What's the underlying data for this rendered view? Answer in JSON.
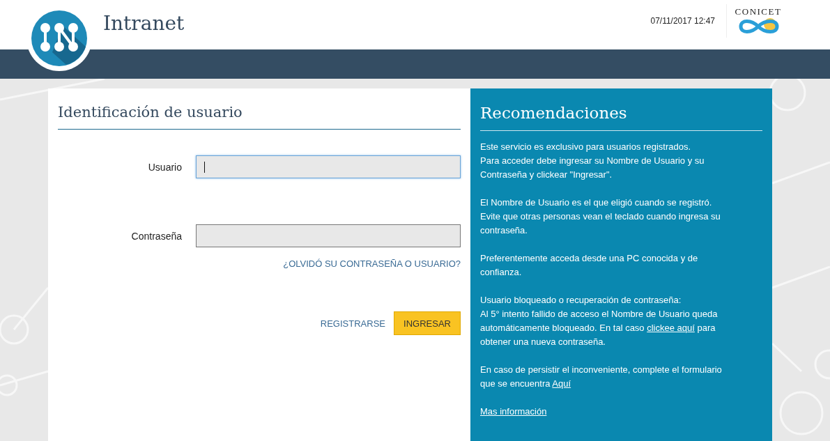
{
  "header": {
    "title": "Intranet",
    "datetime": "07/11/2017 12:47",
    "org_logo_text": "CONICET"
  },
  "login": {
    "heading": "Identificación de usuario",
    "fields": [
      {
        "label": "Usuario",
        "focused": true
      },
      {
        "label": "Contraseña",
        "focused": false
      }
    ],
    "forgot_link": "¿OLVIDÓ SU CONTRASEÑA O USUARIO?",
    "buttons": [
      {
        "label": "REGISTRARSE",
        "kind": "link"
      },
      {
        "label": "INGRESAR",
        "kind": "primary"
      }
    ]
  },
  "recommendations": {
    "heading": "Recomendaciones",
    "paragraphs": [
      [
        {
          "kind": "text",
          "text": "Este servicio es exclusivo para usuarios registrados.\nPara acceder debe ingresar su Nombre de Usuario y su Contraseña y clickear \"Ingresar\"."
        }
      ],
      [
        {
          "kind": "text",
          "text": "El Nombre de Usuario es el que eligió cuando se registró.\nEvite que otras personas vean el teclado cuando ingresa su contraseña."
        }
      ],
      [
        {
          "kind": "text",
          "text": "Preferentemente acceda desde una PC conocida y de confianza."
        }
      ],
      [
        {
          "kind": "text",
          "text": "Usuario bloqueado o recuperación de contraseña:\nAl 5° intento fallido de acceso el Nombre de Usuario queda automáticamente bloqueado. En tal caso "
        },
        {
          "kind": "link",
          "text": "clickee aquí"
        },
        {
          "kind": "text",
          "text": " para obtener una nueva contraseña."
        }
      ],
      [
        {
          "kind": "text",
          "text": "En caso de persistir el inconveniente, complete el formulario que se encuentra "
        },
        {
          "kind": "link",
          "text": "Aquí"
        }
      ],
      [
        {
          "kind": "link",
          "text": "Mas información"
        }
      ]
    ]
  }
}
